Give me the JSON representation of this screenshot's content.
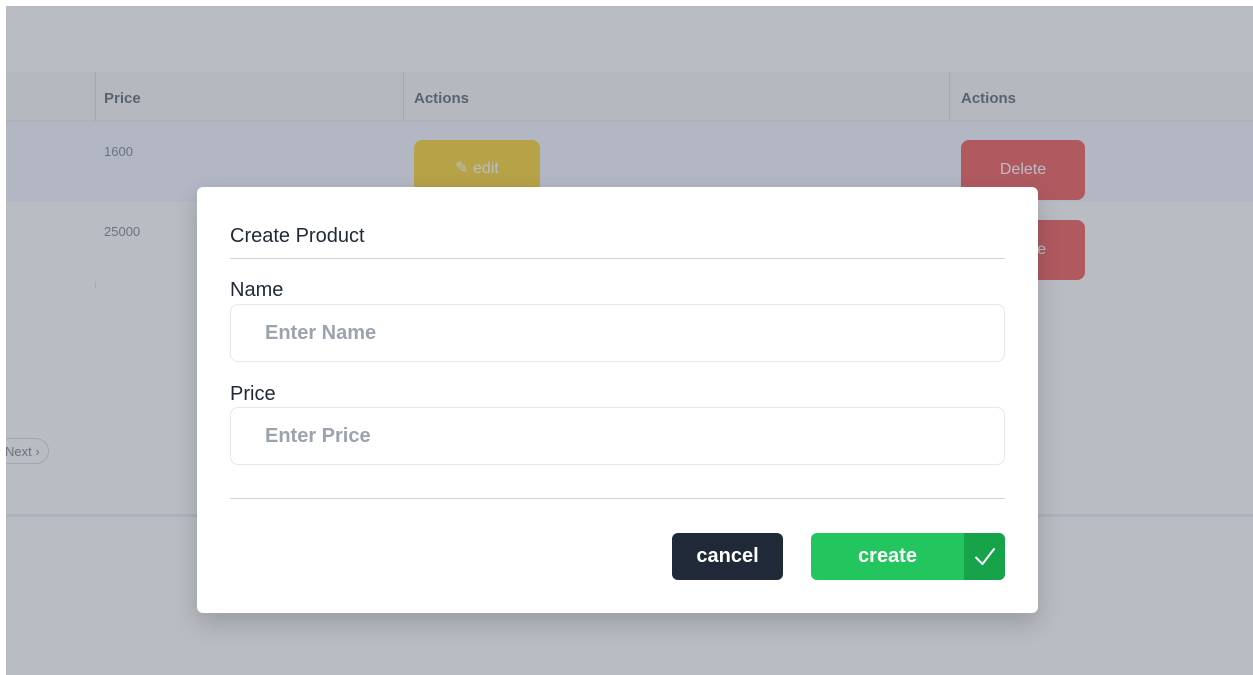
{
  "background": {
    "table": {
      "columns": [
        "Price",
        "Actions",
        "Actions"
      ],
      "rows": [
        {
          "price": "1600",
          "edit_label": "✎ edit",
          "delete_label": "Delete"
        },
        {
          "price": "25000",
          "edit_label": "",
          "delete_label": "Delete"
        }
      ]
    },
    "pager_label": "Next ›"
  },
  "modal": {
    "title": "Create Product",
    "fields": [
      {
        "label": "Name",
        "placeholder": "Enter Name",
        "value": ""
      },
      {
        "label": "Price",
        "placeholder": "Enter Price",
        "value": ""
      }
    ],
    "cancel_label": "cancel",
    "create_label": "create"
  },
  "colors": {
    "overlay": "#6b7280",
    "cancel_button": "#1f2937",
    "create_button": "#22c55e",
    "create_check": "#16a34a",
    "edit_button": "#facc15",
    "delete_button": "#ef4444"
  },
  "icons": {
    "create_check": "check-icon",
    "edit": "pencil-icon"
  }
}
